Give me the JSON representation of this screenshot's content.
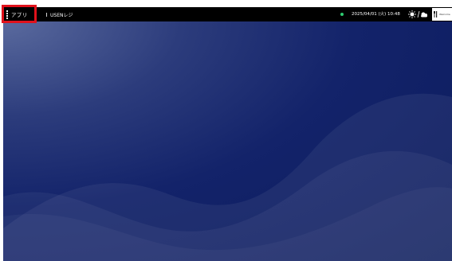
{
  "topbar": {
    "apps_label": "アプリ",
    "app_name": "USENレジ",
    "datetime": "2025/04/01 (火) 10:48",
    "welcome_text": "Welcome"
  },
  "icons": {
    "apps": "grip-dots-icon",
    "status": "status-dot-icon",
    "weather_sun": "sun-icon",
    "weather_cloud": "cloud-icon",
    "welcome": "fork-knife-icon"
  },
  "colors": {
    "topbar": "#000000",
    "desktop": "#0b1b5c",
    "status_dot": "#2ecc71",
    "highlight": "#e0111b"
  }
}
